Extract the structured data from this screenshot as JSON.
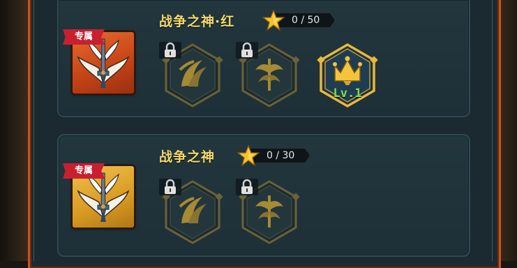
{
  "skills": [
    {
      "title": "战争之神·红",
      "exclusive_label": "专属",
      "stars": "0 / 50",
      "portrait_color": "red",
      "badges": [
        {
          "icon": "wing-claw-icon",
          "locked": true,
          "level": ""
        },
        {
          "icon": "trident-branch-icon",
          "locked": true,
          "level": ""
        },
        {
          "icon": "crown-trident-icon",
          "locked": false,
          "level": "Lv.1"
        }
      ]
    },
    {
      "title": "战争之神",
      "exclusive_label": "专属",
      "stars": "0 / 30",
      "portrait_color": "gold",
      "badges": [
        {
          "icon": "wing-claw-icon",
          "locked": true,
          "level": ""
        },
        {
          "icon": "trident-branch-icon",
          "locked": true,
          "level": ""
        }
      ]
    }
  ],
  "colors": {
    "title": "#f3d96b",
    "frame": "#c8541c",
    "panel": "#1e3037",
    "level_green": "#7fe04a",
    "ribbon_red": "#c82030"
  }
}
